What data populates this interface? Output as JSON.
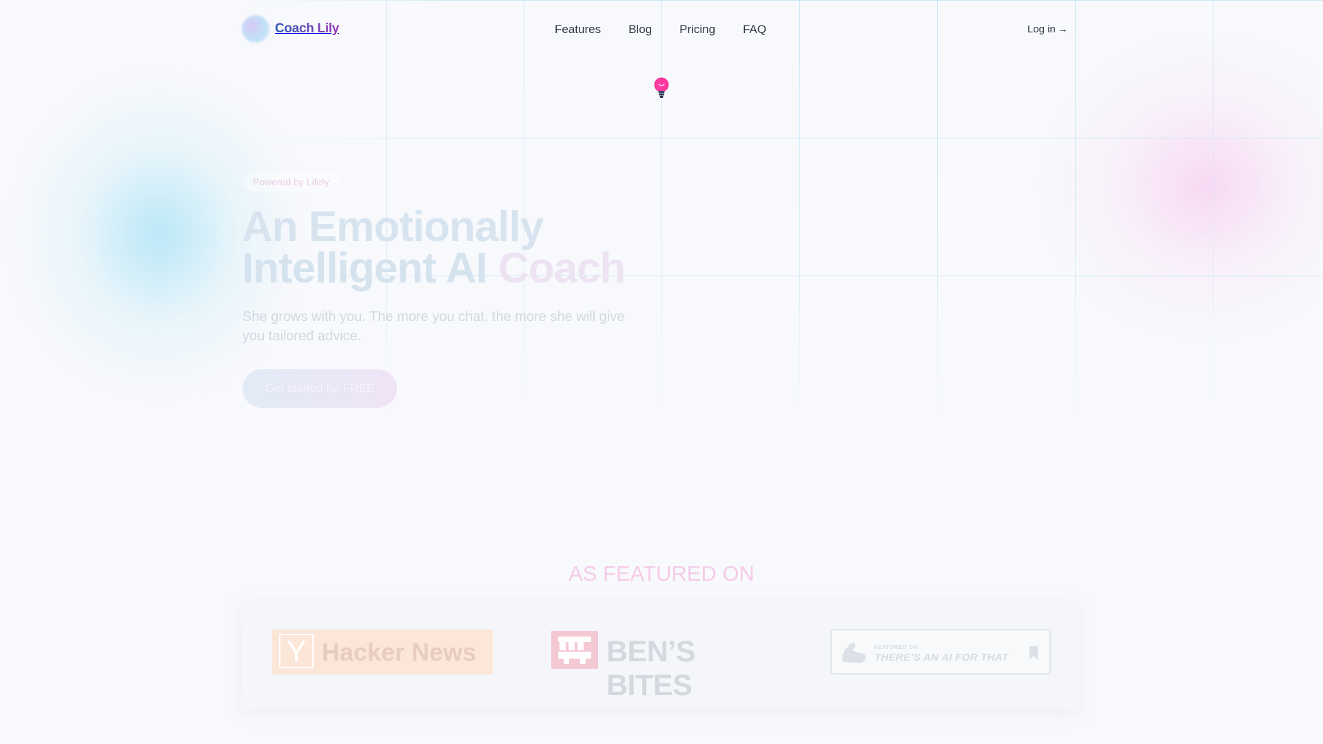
{
  "header": {
    "brand_name": "Coach Lily",
    "nav": [
      "Features",
      "Blog",
      "Pricing",
      "FAQ"
    ],
    "login_label": "Log in",
    "login_arrow": "→"
  },
  "hero": {
    "badge": "Powered by Lifely",
    "title_line1": "An Emotionally",
    "title_line2_a": "Intelligent AI",
    "title_line2_b": "Coach",
    "subtitle": "She grows with you. The more you chat, the more she will give you tailored advice.",
    "cta_label": "Get started for FREE"
  },
  "featured": {
    "heading": "AS FEATURED ON",
    "hacker_news": {
      "mark": "Y",
      "name": "Hacker News"
    },
    "bens_bites": {
      "name": "BEN’S BITES"
    },
    "aift": {
      "kicker": "FEATURED ON",
      "name": "THERE’S AN AI FOR THAT"
    }
  },
  "colors": {
    "background": "#f8f9fc",
    "brand_gradient_start": "#2d5bb4",
    "brand_gradient_end": "#9b36b7",
    "featured_heading": "#f6cbe9",
    "bulb_pink": "#ff3aa0"
  },
  "icons": {
    "brand": "gradient-circle-logo",
    "hero_decoration": "lightbulb-icon",
    "login": "arrow-right-icon"
  }
}
